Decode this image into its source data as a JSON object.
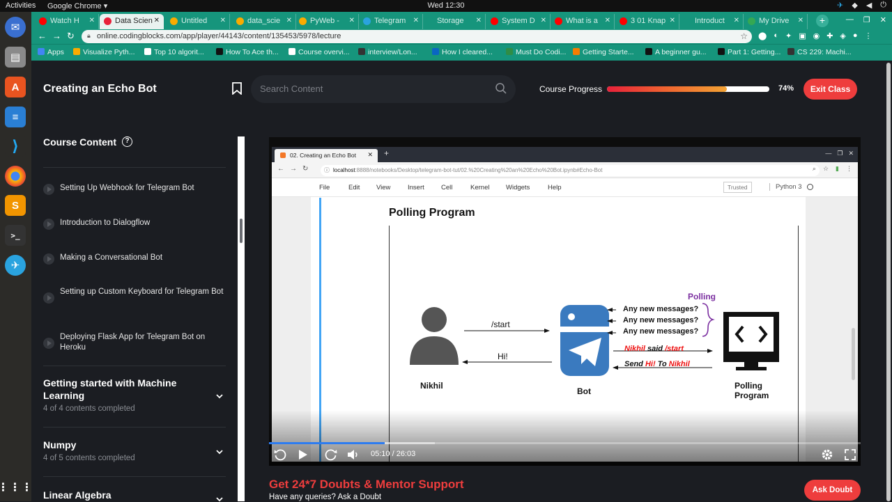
{
  "os_bar": {
    "activities": "Activities",
    "app_name": "Google Chrome ▾",
    "clock": "Wed 12:30"
  },
  "browser": {
    "tabs": [
      {
        "label": "Watch H",
        "color": "#ff0000",
        "active": false
      },
      {
        "label": "Data Scien",
        "color": "#e8213a",
        "active": true
      },
      {
        "label": "Untitled",
        "color": "#f9ab00",
        "active": false
      },
      {
        "label": "data_scie",
        "color": "#f9ab00",
        "active": false
      },
      {
        "label": "PyWeb -",
        "color": "#f9ab00",
        "active": false
      },
      {
        "label": "Telegram",
        "color": "#2aa3df",
        "active": false
      },
      {
        "label": "Storage",
        "color": "#16957c",
        "active": false
      },
      {
        "label": "System D",
        "color": "#ff0000",
        "active": false
      },
      {
        "label": "What is a",
        "color": "#ff0000",
        "active": false
      },
      {
        "label": "3 01 Knap",
        "color": "#ff0000",
        "active": false
      },
      {
        "label": "Introduct",
        "color": "#16957c",
        "active": false
      },
      {
        "label": "My Drive",
        "color": "#34a853",
        "active": false
      }
    ],
    "url": "online.codingblocks.com/app/player/44143/content/135453/5978/lecture",
    "bookmarks": [
      {
        "label": "Apps",
        "color": "#4285f4"
      },
      {
        "label": "Visualize Pyth...",
        "color": "#f9ab00"
      },
      {
        "label": "Top 10 algorit...",
        "color": "#ffffff"
      },
      {
        "label": "How To Ace th...",
        "color": "#111111"
      },
      {
        "label": "Course overvi...",
        "color": "#ffffff"
      },
      {
        "label": "interview/Lon...",
        "color": "#333333"
      },
      {
        "label": "How I cleared...",
        "color": "#0a66c2"
      },
      {
        "label": "Must Do Codi...",
        "color": "#2f8d46"
      },
      {
        "label": "Getting Starte...",
        "color": "#f57d00"
      },
      {
        "label": "A beginner gu...",
        "color": "#111111"
      },
      {
        "label": "Part 1: Getting...",
        "color": "#111111"
      },
      {
        "label": "CS 229: Machi...",
        "color": "#333333"
      }
    ]
  },
  "header": {
    "title": "Creating an Echo Bot",
    "search_placeholder": "Search Content",
    "progress_label": "Course Progress",
    "progress_value": 0.74,
    "progress_text": "74%",
    "exit_label": "Exit Class"
  },
  "sidebar": {
    "heading": "Course Content",
    "lessons": [
      "Setting Up Webhook for Telegram Bot",
      "Introduction to Dialogflow",
      "Making a Conversational Bot",
      "Setting up Custom Keyboard for Telegram Bot",
      "Deploying Flask App for Telegram Bot on Heroku"
    ],
    "sections": [
      {
        "title": "Getting started with Machine Learning",
        "subtitle": "4 of 4 contents completed"
      },
      {
        "title": "Numpy",
        "subtitle": "4 of 5 contents completed"
      },
      {
        "title": "Linear Algebra",
        "subtitle": ""
      }
    ]
  },
  "video": {
    "inner_tab": "02. Creating an Echo Bot",
    "inner_url_host": "localhost",
    "inner_url_path": ":8888/notebooks/Desktop/telegram-bot-tut/02.%20Creating%20an%20Echo%20Bot.ipynb#Echo-Bot",
    "nb_menu": [
      "File",
      "Edit",
      "View",
      "Insert",
      "Cell",
      "Kernel",
      "Widgets",
      "Help"
    ],
    "trusted": "Trusted",
    "kernel": "Python 3",
    "cell_heading": "Polling Program",
    "diagram": {
      "user_label": "Nikhil",
      "bot_label": "Bot",
      "program_label_1": "Polling",
      "program_label_2": "Program",
      "start_msg": "/start",
      "reply_msg": "Hi!",
      "polling_label": "Polling",
      "queries": [
        "Any new messages?",
        "Any new messages?",
        "Any new messages?"
      ],
      "said_name": "Nikhil",
      "said_mid": "said",
      "said_cmd": "/start",
      "send_pre": "Send",
      "send_word": "Hi!",
      "send_to": "To",
      "send_name": "Nikhil"
    },
    "timecode": "05:10 / 26:03",
    "played_fraction": 0.196,
    "buffered_fraction": 0.28
  },
  "footer": {
    "doubt_title": "Get 24*7 Doubts & Mentor Support",
    "doubt_subtitle": "Have any queries? Ask a Doubt",
    "ask_label": "Ask Doubt"
  },
  "colors": {
    "accent": "#ee3d3d",
    "chrome_theme": "#16957c",
    "background": "#1b1d22",
    "telegram_blue": "#2aa3df",
    "python_blue": "#3a7abf"
  }
}
